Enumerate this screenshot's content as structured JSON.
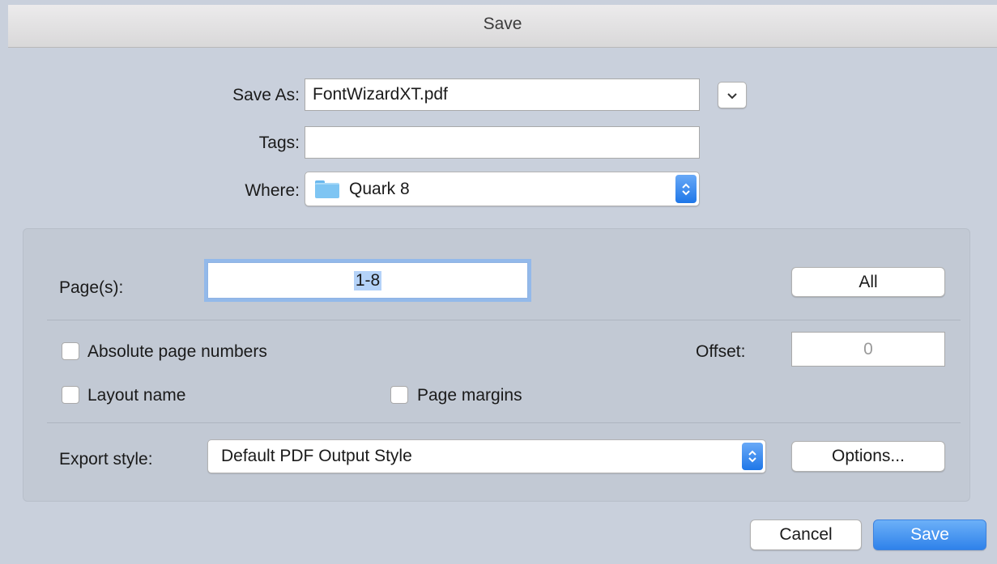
{
  "dialog": {
    "title": "Save"
  },
  "save_as": {
    "label": "Save As:",
    "value": "FontWizardXT.pdf"
  },
  "tags": {
    "label": "Tags:",
    "value": ""
  },
  "where": {
    "label": "Where:",
    "value": "Quark 8",
    "icon": "folder-icon"
  },
  "pages": {
    "label": "Page(s):",
    "value": "1-8",
    "all_button": "All"
  },
  "options": {
    "absolute_page_numbers": "Absolute page numbers",
    "offset_label": "Offset:",
    "offset_value": "0",
    "layout_name": "Layout name",
    "page_margins": "Page margins"
  },
  "export": {
    "label": "Export style:",
    "value": "Default PDF Output Style",
    "options_button": "Options..."
  },
  "footer": {
    "cancel": "Cancel",
    "save": "Save"
  },
  "colors": {
    "accent": "#2f82ea",
    "dialog_bg": "#c9d0dc",
    "panel_bg": "#c2c9d4"
  }
}
